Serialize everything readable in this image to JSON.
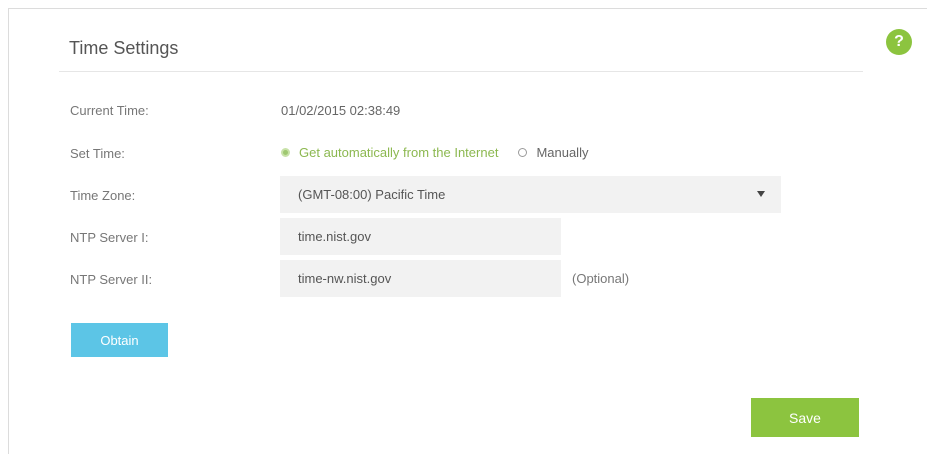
{
  "header": {
    "title": "Time Settings",
    "help_icon": "question-icon",
    "help_glyph": "?"
  },
  "form": {
    "current_time": {
      "label": "Current Time:",
      "value": "01/02/2015 02:38:49"
    },
    "set_time": {
      "label": "Set Time:",
      "options": [
        {
          "label": "Get automatically from the Internet",
          "selected": true
        },
        {
          "label": "Manually",
          "selected": false
        }
      ]
    },
    "time_zone": {
      "label": "Time Zone:",
      "value": "(GMT-08:00) Pacific Time",
      "icon": "chevron-down-icon"
    },
    "ntp_server_1": {
      "label": "NTP Server I:",
      "value": "time.nist.gov"
    },
    "ntp_server_2": {
      "label": "NTP Server II:",
      "value": "time-nw.nist.gov",
      "note": "(Optional)"
    }
  },
  "buttons": {
    "obtain": "Obtain",
    "save": "Save"
  },
  "colors": {
    "accent_green": "#8cc43f",
    "obtain_blue": "#5cc5e6",
    "field_bg": "#f2f2f2"
  }
}
